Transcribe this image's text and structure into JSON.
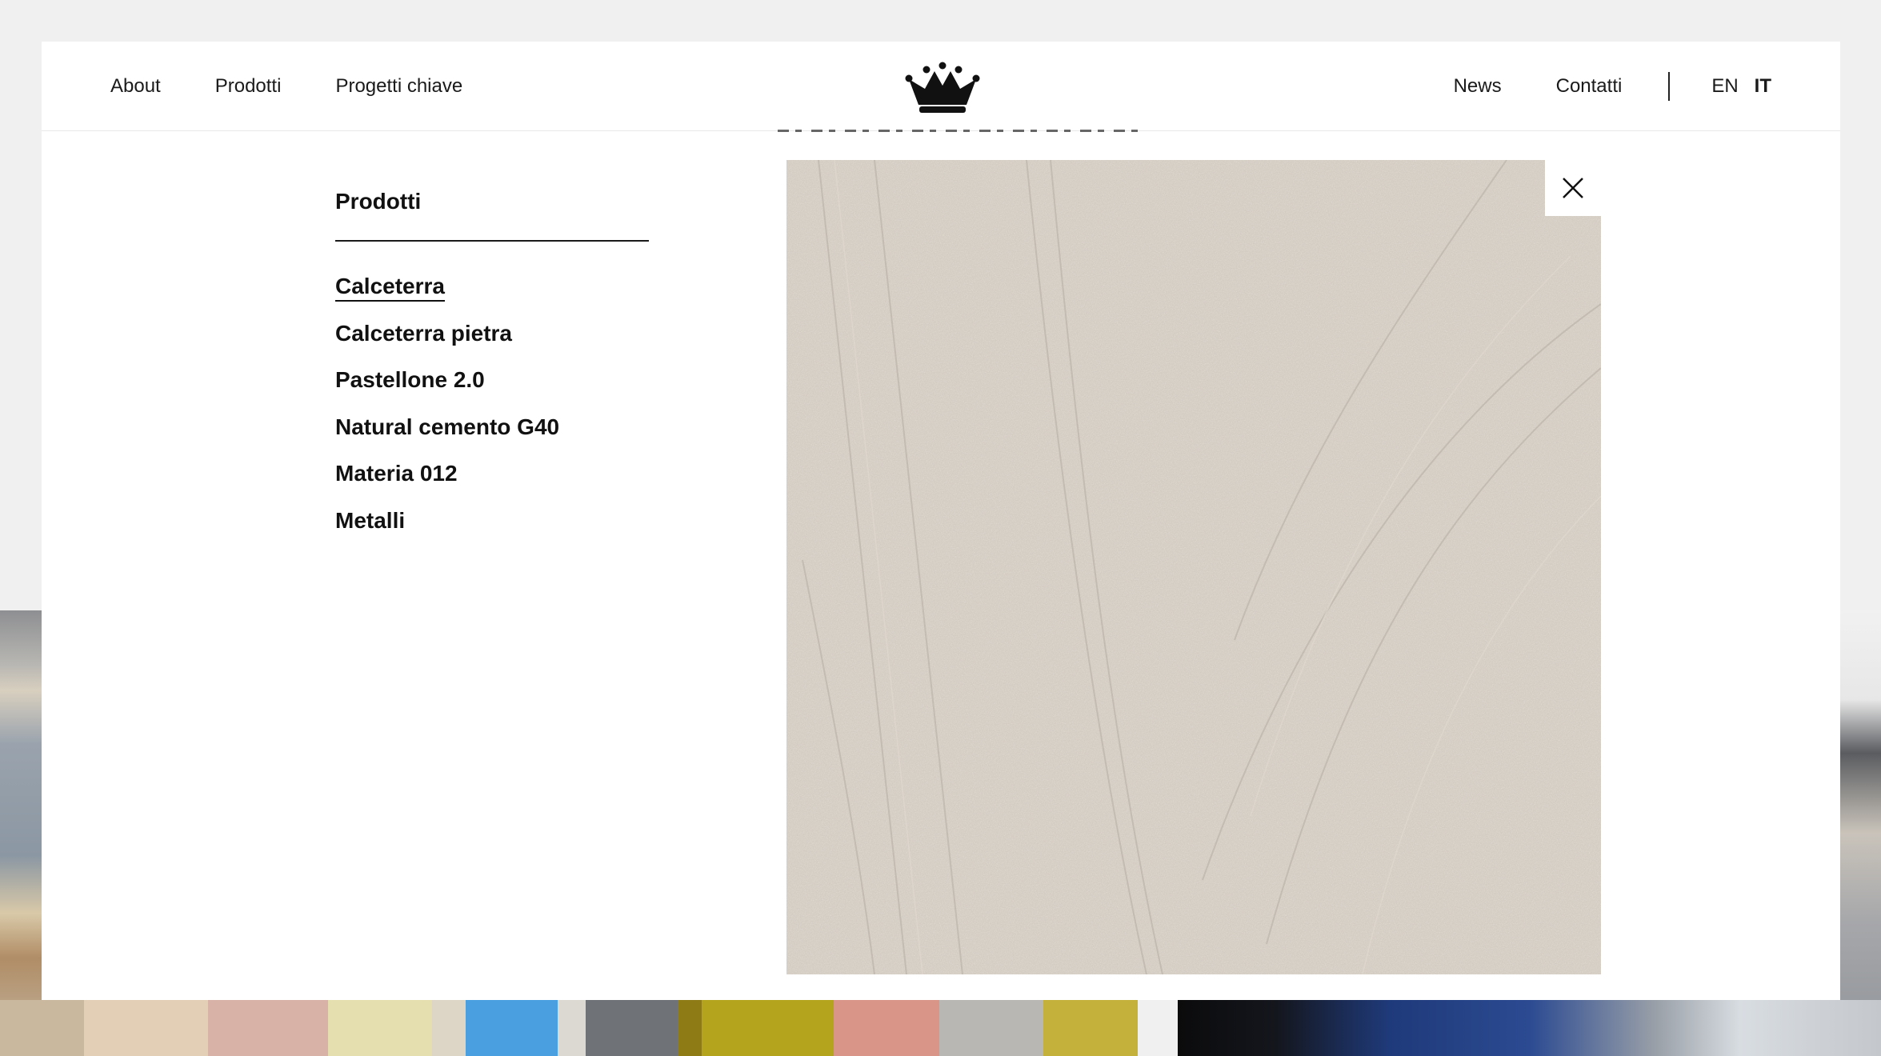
{
  "header": {
    "nav_left": [
      "About",
      "Prodotti",
      "Progetti chiave"
    ],
    "logo_icon": "crown-icon",
    "nav_right": [
      "News",
      "Contatti"
    ],
    "languages": [
      "EN",
      "IT"
    ],
    "active_language": "IT"
  },
  "menu": {
    "title": "Prodotti",
    "items": [
      "Calceterra",
      "Calceterra pietra",
      "Pastellone 2.0",
      "Natural cemento G40",
      "Materia 012",
      "Metalli"
    ],
    "active_item": "Calceterra"
  },
  "preview": {
    "image": "textured-plaster-preview",
    "close_icon": "close-icon"
  },
  "colors": {
    "modal_bg": "#ffffff",
    "page_bg": "#efefef",
    "text": "#111111",
    "texture": "#cfc7bd"
  },
  "background": {
    "swatch_colors": [
      "#c9b79e",
      "#e2cfb5",
      "#d8b2a6",
      "#e5dfb0",
      "#ddd6c6",
      "#4a9fe0",
      "#dcd8d2",
      "#6f7378",
      "#8f7b16",
      "#b4a31d",
      "#d99688",
      "#b9b7b3",
      "#c4b13c"
    ]
  }
}
